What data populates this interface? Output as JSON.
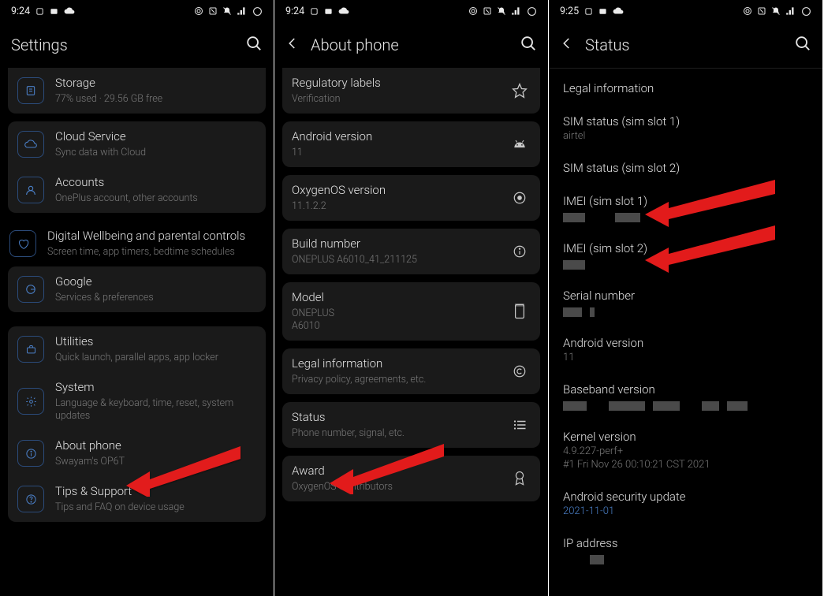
{
  "status_bar": {
    "p1": {
      "time": "9:24"
    },
    "p2": {
      "time": "9:24"
    },
    "p3": {
      "time": "9:25"
    }
  },
  "panel1": {
    "header": {
      "title": "Settings"
    },
    "storage": {
      "title": "Storage",
      "sub": "77% used · 29.56 GB free"
    },
    "cloud": {
      "title": "Cloud Service",
      "sub": "Sync data with Cloud"
    },
    "accounts": {
      "title": "Accounts",
      "sub": "OnePlus account, other accounts"
    },
    "wellbeing": {
      "title": "Digital Wellbeing and parental controls",
      "sub": "Screen time, app timers, bedtime schedules"
    },
    "google": {
      "title": "Google",
      "sub": "Services & preferences"
    },
    "utilities": {
      "title": "Utilities",
      "sub": "Quick launch, parallel apps, app locker"
    },
    "system": {
      "title": "System",
      "sub": "Language & keyboard, time, reset, system updates"
    },
    "about": {
      "title": "About phone",
      "sub": "Swayam's OP6T"
    },
    "tips": {
      "title": "Tips & Support",
      "sub": "Tips and FAQ on device usage"
    }
  },
  "panel2": {
    "header": {
      "title": "About phone"
    },
    "regulatory": {
      "title": "Regulatory labels",
      "sub": "Verification"
    },
    "android": {
      "title": "Android version",
      "sub": "11"
    },
    "oxygen": {
      "title": "OxygenOS version",
      "sub": "11.1.2.2"
    },
    "build": {
      "title": "Build number",
      "sub": "ONEPLUS A6010_41_211125"
    },
    "model": {
      "title": "Model",
      "sub": "ONEPLUS A6010"
    },
    "legal": {
      "title": "Legal information",
      "sub": "Privacy policy, agreements, etc."
    },
    "status": {
      "title": "Status",
      "sub": "Phone number, signal, etc."
    },
    "award": {
      "title": "Award",
      "sub": "OxygenOS Contributors"
    }
  },
  "panel3": {
    "header": {
      "title": "Status"
    },
    "legal": {
      "title": "Legal information"
    },
    "sim1": {
      "title": "SIM status (sim slot 1)",
      "sub": "airtel"
    },
    "sim2": {
      "title": "SIM status (sim slot 2)"
    },
    "imei1": {
      "title": "IMEI (sim slot 1)"
    },
    "imei2": {
      "title": "IMEI (sim slot 2)"
    },
    "serial": {
      "title": "Serial number"
    },
    "android": {
      "title": "Android version",
      "sub": "11"
    },
    "baseband": {
      "title": "Baseband version"
    },
    "kernel": {
      "title": "Kernel version",
      "sub1": "4.9.227-perf+",
      "sub2": "#1 Fri Nov 26 00:10:21 CST 2021"
    },
    "security": {
      "title": "Android security update",
      "sub": "2021-11-01"
    },
    "ip": {
      "title": "IP address"
    }
  }
}
